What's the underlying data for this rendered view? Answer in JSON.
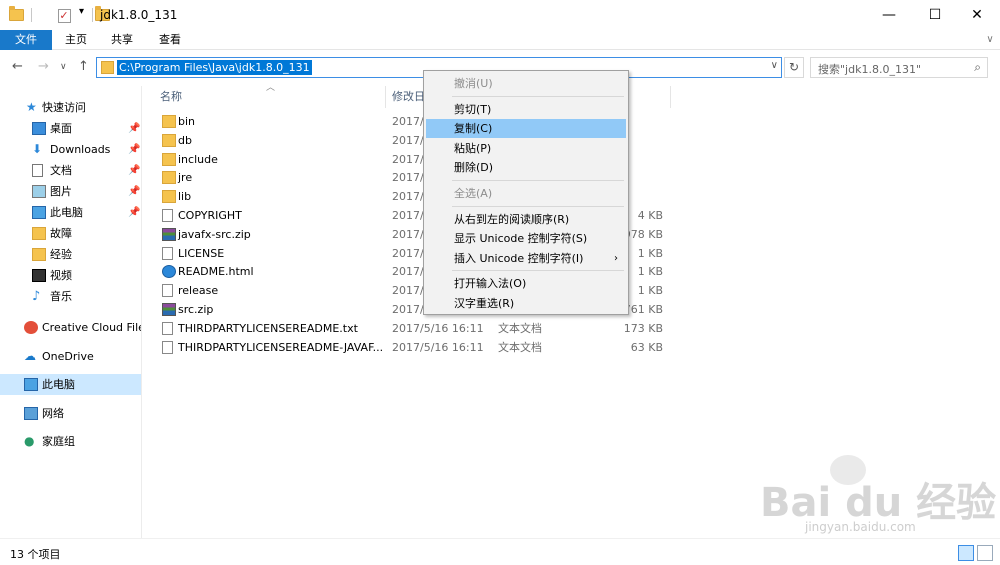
{
  "window": {
    "title": "jdk1.8.0_131",
    "minimize": "—",
    "maximize": "☐",
    "close": "✕"
  },
  "ribbon": {
    "tabs": [
      "文件",
      "主页",
      "共享",
      "查看"
    ]
  },
  "nav": {
    "back": "←",
    "forward": "→",
    "recent": "∨",
    "up": "↑",
    "address": "C:\\Program Files\\Java\\jdk1.8.0_131",
    "search_placeholder": "搜索\"jdk1.8.0_131\""
  },
  "sidebar": {
    "items": [
      {
        "label": "快速访问",
        "icon": "star-icon"
      },
      {
        "label": "桌面",
        "icon": "desktop-icon",
        "pinned": true
      },
      {
        "label": "Downloads",
        "icon": "download-icon",
        "pinned": true
      },
      {
        "label": "文档",
        "icon": "document-icon",
        "pinned": true
      },
      {
        "label": "图片",
        "icon": "picture-icon",
        "pinned": true
      },
      {
        "label": "此电脑",
        "icon": "computer-icon",
        "pinned": true
      },
      {
        "label": "故障",
        "icon": "folder-icon"
      },
      {
        "label": "经验",
        "icon": "folder-icon"
      },
      {
        "label": "视频",
        "icon": "video-icon"
      },
      {
        "label": "音乐",
        "icon": "music-icon"
      },
      {
        "label": "Creative Cloud Files",
        "icon": "creative-cloud-icon"
      },
      {
        "label": "OneDrive",
        "icon": "cloud-icon"
      },
      {
        "label": "此电脑",
        "icon": "computer-icon"
      },
      {
        "label": "网络",
        "icon": "network-icon"
      },
      {
        "label": "家庭组",
        "icon": "homegroup-icon"
      }
    ]
  },
  "columns": {
    "name": "名称",
    "date": "修改日"
  },
  "files": [
    {
      "name": "bin",
      "date": "2017/5",
      "type": "",
      "size": "",
      "icon": "folder"
    },
    {
      "name": "db",
      "date": "2017/5",
      "type": "",
      "size": "",
      "icon": "folder"
    },
    {
      "name": "include",
      "date": "2017/5",
      "type": "",
      "size": "",
      "icon": "folder"
    },
    {
      "name": "jre",
      "date": "2017/5",
      "type": "",
      "size": "",
      "icon": "folder"
    },
    {
      "name": "lib",
      "date": "2017/5",
      "type": "",
      "size": "",
      "icon": "folder"
    },
    {
      "name": "COPYRIGHT",
      "date": "2017/",
      "type": "",
      "size": "4 KB",
      "icon": "doc"
    },
    {
      "name": "javafx-src.zip",
      "date": "2017/",
      "type": "",
      "size": "978 KB",
      "icon": "zip"
    },
    {
      "name": "LICENSE",
      "date": "2017/5",
      "type": "",
      "size": "1 KB",
      "icon": "doc"
    },
    {
      "name": "README.html",
      "date": "2017/5",
      "type": "",
      "size": "1 KB",
      "icon": "html"
    },
    {
      "name": "release",
      "date": "2017/5",
      "type": "",
      "size": "1 KB",
      "icon": "doc"
    },
    {
      "name": "src.zip",
      "date": "2017/",
      "type": "",
      "size": "761 KB",
      "icon": "zip"
    },
    {
      "name": "THIRDPARTYLICENSEREADME.txt",
      "date": "2017/5/16 16:11",
      "type": "文本文档",
      "size": "173 KB",
      "icon": "doc"
    },
    {
      "name": "THIRDPARTYLICENSEREADME-JAVAF...",
      "date": "2017/5/16 16:11",
      "type": "文本文档",
      "size": "63 KB",
      "icon": "doc"
    }
  ],
  "context_menu": {
    "items": [
      {
        "label": "撤消(U)",
        "disabled": true
      },
      {
        "sep": true
      },
      {
        "label": "剪切(T)"
      },
      {
        "label": "复制(C)",
        "highlighted": true
      },
      {
        "label": "粘贴(P)"
      },
      {
        "label": "删除(D)"
      },
      {
        "sep": true
      },
      {
        "label": "全选(A)",
        "disabled": true
      },
      {
        "sep": true
      },
      {
        "label": "从右到左的阅读顺序(R)"
      },
      {
        "label": "显示 Unicode 控制字符(S)"
      },
      {
        "label": "插入 Unicode 控制字符(I)",
        "submenu": true
      },
      {
        "sep": true
      },
      {
        "label": "打开输入法(O)"
      },
      {
        "label": "汉字重选(R)"
      }
    ]
  },
  "status": {
    "count": "13 个项目"
  },
  "watermark": {
    "brand": "Bai du 经验",
    "url": "jingyan.baidu.com"
  }
}
